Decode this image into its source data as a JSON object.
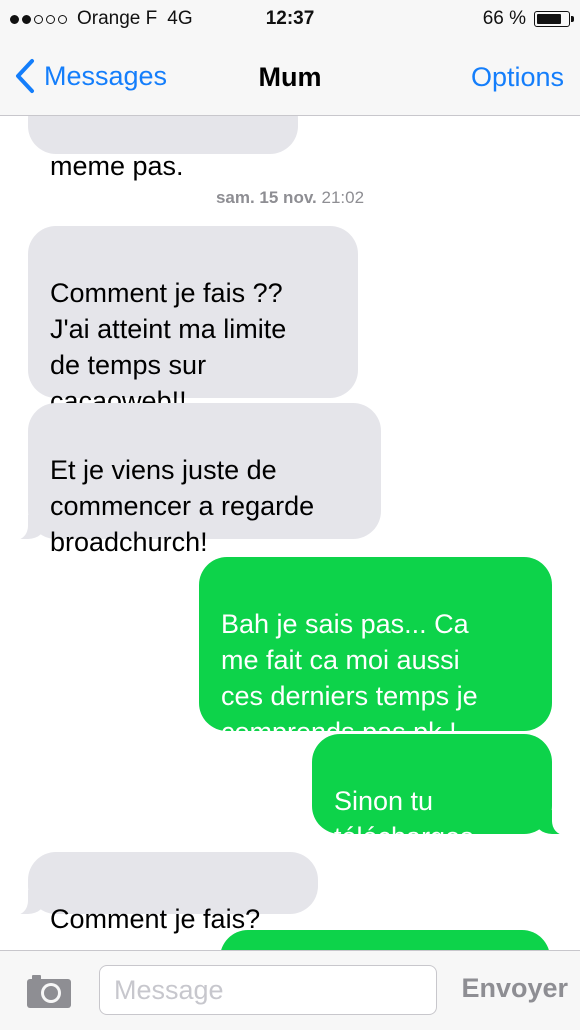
{
  "status_bar": {
    "carrier": "Orange F",
    "network": "4G",
    "signal_bars": 2,
    "signal_total": 5,
    "time": "12:37",
    "battery_percent_text": "66 %",
    "battery_level": 0.8
  },
  "nav": {
    "back_label": "Messages",
    "title": "Mum",
    "options_label": "Options"
  },
  "timestamp": {
    "day": "sam. 15 nov.",
    "time": "21:02"
  },
  "messages": [
    {
      "dir": "in",
      "text": "meme pas."
    },
    {
      "dir": "in",
      "text": "Comment je fais ??\nJ'ai atteint ma limite\nde temps sur\ncacaoweb!!"
    },
    {
      "dir": "in",
      "text": "Et je viens juste de\ncommencer a regarde\nbroadchurch!"
    },
    {
      "dir": "out",
      "text": "Bah je sais pas... Ca\nme fait ca moi aussi\nces derniers temps je\ncomprends pas pk !"
    },
    {
      "dir": "out",
      "text": "Sinon tu\ntélécharges ..."
    },
    {
      "dir": "in",
      "text": "Comment je fais?"
    },
    {
      "dir": "out",
      "text": ""
    }
  ],
  "input": {
    "placeholder": "Message",
    "value": "",
    "send_label": "Envoyer"
  },
  "colors": {
    "accent": "#147efb",
    "incoming_bubble": "#e5e5ea",
    "outgoing_bubble": "#0dd34a"
  },
  "icons": {
    "back": "chevron-left-icon",
    "camera": "camera-icon"
  }
}
